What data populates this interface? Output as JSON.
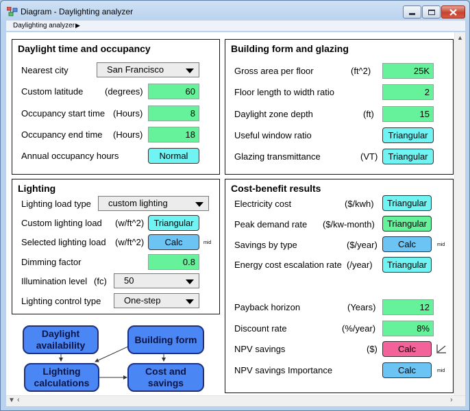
{
  "window": {
    "title": "Diagram - Daylighting analyzer",
    "breadcrumb": "Daylighting analyzer",
    "breadcrumb_arrow": "▶"
  },
  "daylight": {
    "title": "Daylight time and occupancy",
    "nearest_city": {
      "label": "Nearest city",
      "value": "San Francisco"
    },
    "custom_latitude": {
      "label": "Custom latitude",
      "unit": "(degrees)",
      "value": "60"
    },
    "occ_start": {
      "label": "Occupancy start time",
      "unit": "(Hours)",
      "value": "8"
    },
    "occ_end": {
      "label": "Occupancy end time",
      "unit": "(Hours)",
      "value": "18"
    },
    "annual_hours": {
      "label": "Annual occupancy hours",
      "value": "Normal"
    }
  },
  "building": {
    "title": "Building form and glazing",
    "gross_area": {
      "label": "Gross area per floor",
      "unit": "(ft^2)",
      "value": "25K"
    },
    "length_width": {
      "label": "Floor length to width ratio",
      "value": "2"
    },
    "zone_depth": {
      "label": "Daylight zone depth",
      "unit": "(ft)",
      "value": "15"
    },
    "window_ratio": {
      "label": "Useful window ratio",
      "value": "Triangular"
    },
    "glazing": {
      "label": "Glazing transmittance",
      "unit": "(VT)",
      "value": "Triangular"
    }
  },
  "lighting": {
    "title": "Lighting",
    "load_type": {
      "label": "Lighting load type",
      "value": "custom lighting"
    },
    "custom_load": {
      "label": "Custom lighting load",
      "unit": "(w/ft^2)",
      "value": "Triangular"
    },
    "selected_load": {
      "label": "Selected lighting load",
      "unit": "(w/ft^2)",
      "value": "Calc",
      "tag": "mid"
    },
    "dimming": {
      "label": "Dimming factor",
      "value": "0.8"
    },
    "illumination": {
      "label": "Illumination level",
      "unit": "(fc)",
      "value": "50"
    },
    "control_type": {
      "label": "Lighting control type",
      "value": "One-step"
    }
  },
  "cost": {
    "title": "Cost-benefit results",
    "electricity": {
      "label": "Electricity cost",
      "unit": "($/kwh)",
      "value": "Triangular"
    },
    "peak_demand": {
      "label": "Peak demand rate",
      "unit": "($/kw-month)",
      "value": "Triangular"
    },
    "savings_type": {
      "label": "Savings by type",
      "unit": "($/year)",
      "value": "Calc",
      "tag": "mid"
    },
    "escalation": {
      "label": "Energy cost escalation rate",
      "unit": "(/year)",
      "value": "Triangular"
    },
    "payback": {
      "label": "Payback horizon",
      "unit": "(Years)",
      "value": "12"
    },
    "discount": {
      "label": "Discount rate",
      "unit": "(%/year)",
      "value": "8%"
    },
    "npv": {
      "label": "NPV savings",
      "unit": "($)",
      "value": "Calc"
    },
    "npv_importance": {
      "label": "NPV savings Importance",
      "value": "Calc",
      "tag": "mid"
    }
  },
  "diagram": {
    "daylight_availability": "Daylight availability",
    "building_form": "Building form",
    "lighting_calculations": "Lighting calculations",
    "cost_and_savings": "Cost and savings"
  },
  "colors": {
    "numeric_input": "#66f29a",
    "distribution_input": "#6ff3f3",
    "calc_button": "#6cc4f4",
    "objective_button": "#f4629a",
    "node_fill": "#4b87f4"
  }
}
